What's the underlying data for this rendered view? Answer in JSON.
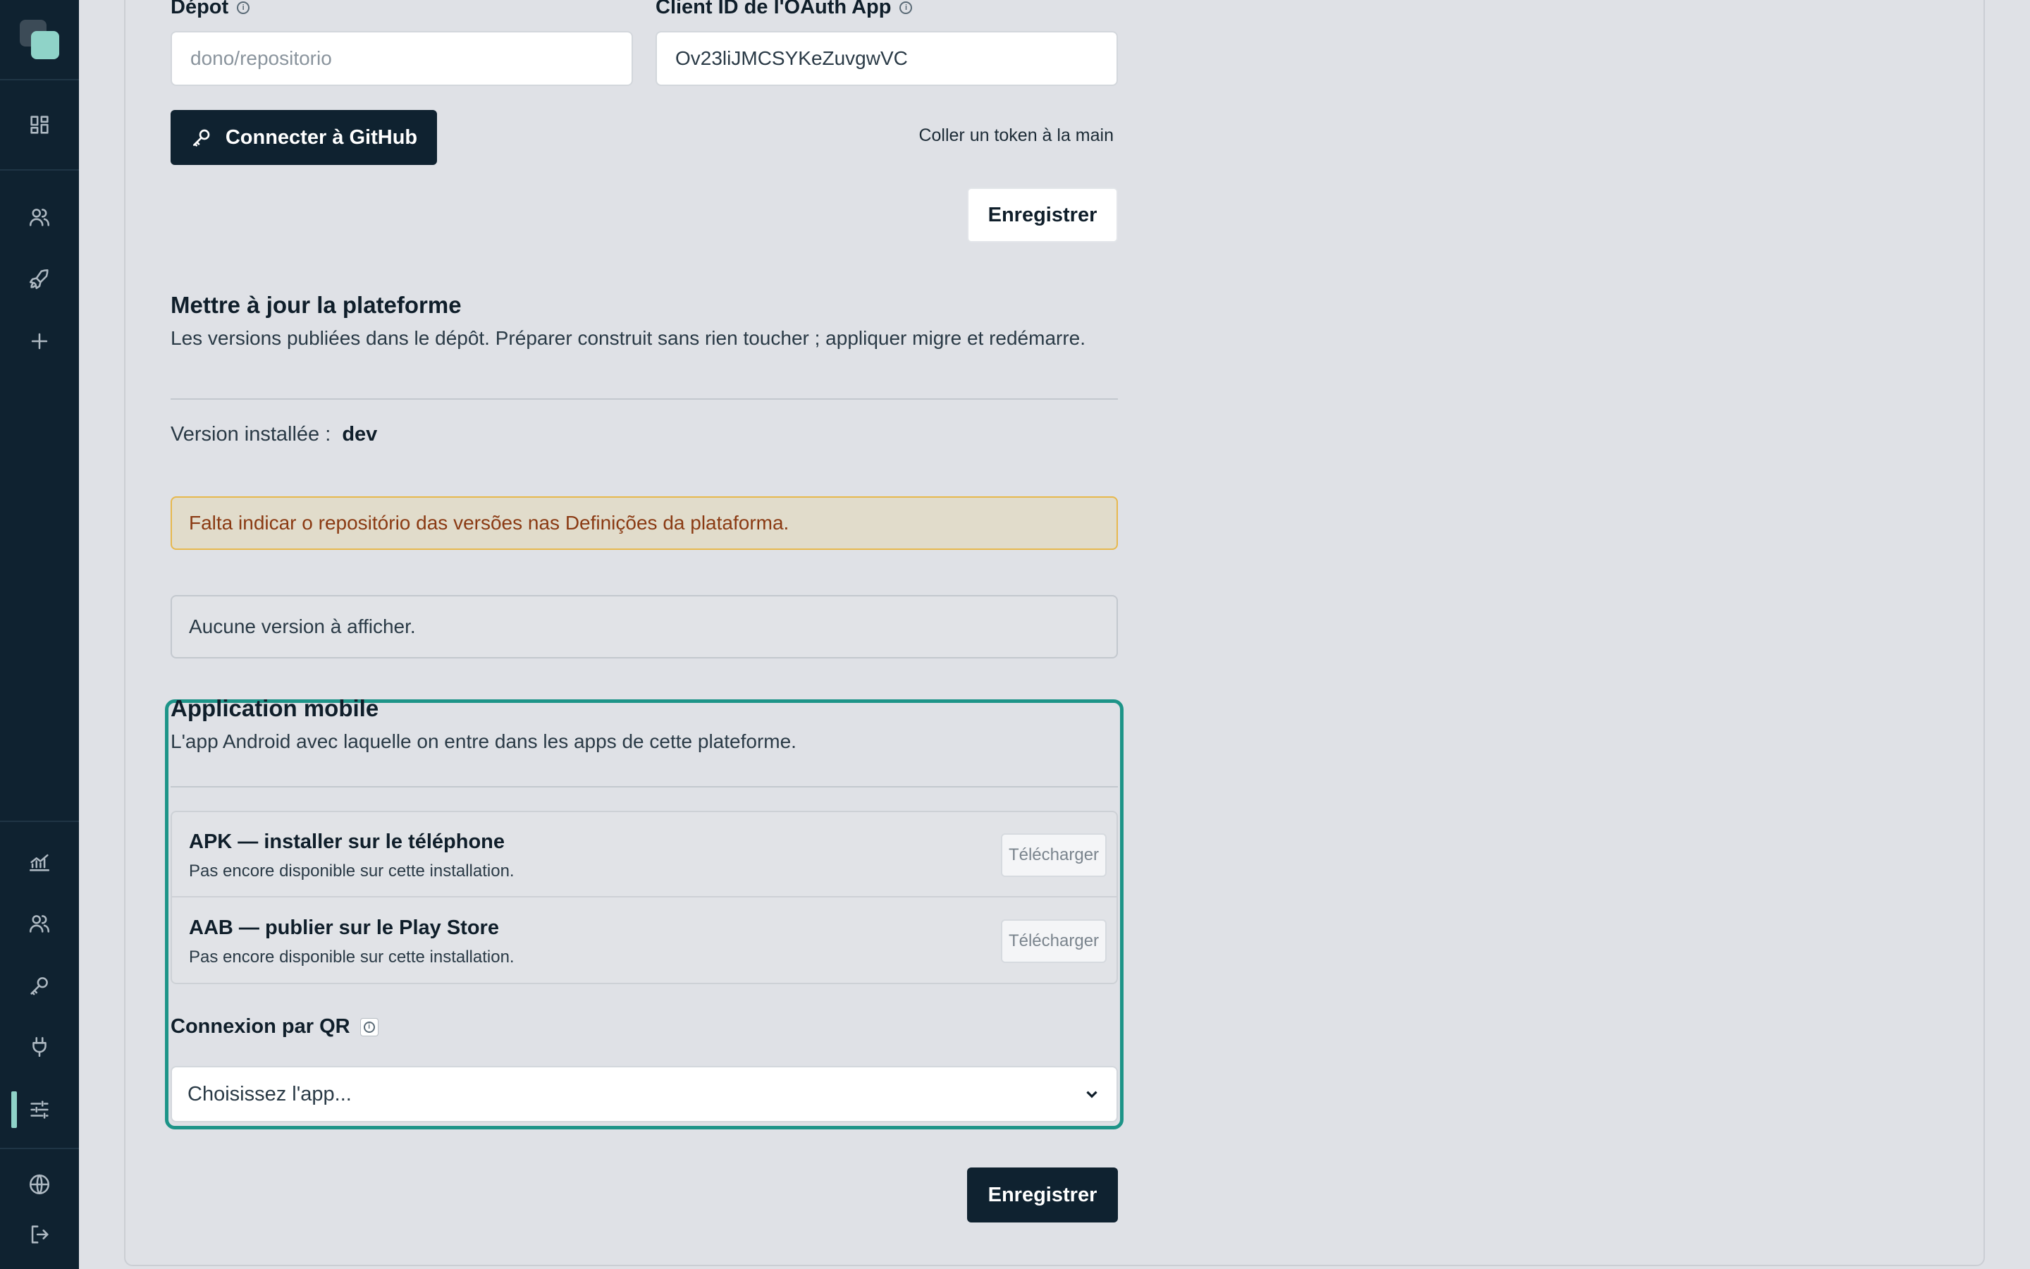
{
  "github": {
    "repo_label": "Dépot",
    "repo_placeholder": "dono/repositorio",
    "client_id_label": "Client ID de l'OAuth App",
    "client_id_value": "Ov23liJMCSYKeZuvgwVC",
    "connect_button": "Connecter à GitHub",
    "paste_token_link": "Coller un token à la main",
    "save_button": "Enregistrer"
  },
  "update": {
    "title": "Mettre à jour la plateforme",
    "description": "Les versions publiées dans le dépôt. Préparer construit sans rien toucher ; appliquer migre et redémarre.",
    "installed_label": "Version installée :",
    "installed_value": "dev",
    "warning": "Falta indicar o repositório das versões nas Definições da plataforma.",
    "empty": "Aucune version à afficher."
  },
  "mobile": {
    "title": "Application mobile",
    "description": "L'app Android avec laquelle on entre dans les apps de cette plateforme.",
    "items": [
      {
        "title": "APK — installer sur le téléphone",
        "subtitle": "Pas encore disponible sur cette installation.",
        "button": "Télécharger"
      },
      {
        "title": "AAB — publier sur le Play Store",
        "subtitle": "Pas encore disponible sur cette installation.",
        "button": "Télécharger"
      }
    ],
    "qr_label": "Connexion par QR",
    "qr_select": "Choisissez l'app...",
    "save_button": "Enregistrer"
  },
  "icons": {
    "sidebar": [
      "dashboard-icon",
      "users-icon",
      "rocket-icon",
      "plus-icon",
      "chart-icon",
      "team-icon",
      "key-icon",
      "plug-icon",
      "sliders-icon",
      "globe-icon",
      "logout-icon"
    ],
    "accent": "#1d9488",
    "sidebar_bg": "#0f2230"
  }
}
